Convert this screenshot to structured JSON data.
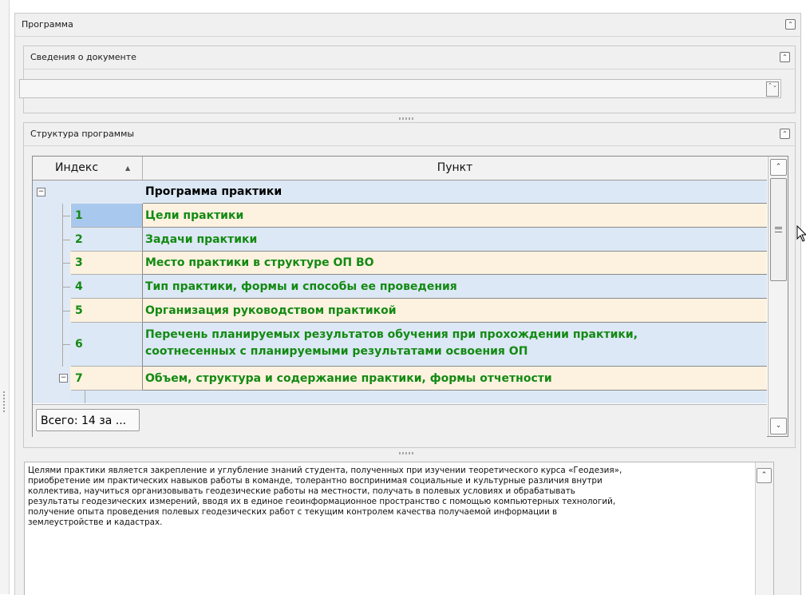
{
  "program_panel": {
    "title": "Программа"
  },
  "document_info": {
    "title": "Сведения о документе",
    "field_value": ""
  },
  "structure": {
    "title": "Структура программы",
    "columns": {
      "index": "Индекс",
      "item": "Пункт"
    },
    "rows": [
      {
        "index": "",
        "label": "Программа практики",
        "style": "header"
      },
      {
        "index": "1",
        "label": "Цели практики"
      },
      {
        "index": "2",
        "label": "Задачи практики"
      },
      {
        "index": "3",
        "label": "Место практики в структуре ОП ВО"
      },
      {
        "index": "4",
        "label": "Тип практики, формы и способы ее проведения"
      },
      {
        "index": "5",
        "label": "Организация руководством практикой"
      },
      {
        "index": "6",
        "label": "Перечень планируемых результатов обучения при прохождении практики,\nсоотнесенных с планируемыми результатами освоения ОП"
      },
      {
        "index": "7",
        "label": "Объем, структура и содержание практики, формы отчетности"
      }
    ],
    "footer_label": "Всего: 14 за ..."
  },
  "description": {
    "text": "Целями практики является закрепление и углубление знаний студента, полученных при изучении теоретического курса «Геодезия»,\nприобретение им практических навыков работы в команде, толерантно воспринимая социальные и культурные различия внутри\nколлектива, научиться организовывать геодезические работы на местности, получать в полевых условиях и обрабатывать\nрезультаты геодезических измерений, вводя их в единое геоинформационное пространство с помощью компьютерных технологий,\nполучение опыта проведения полевых геодезических работ с текущим контролем качества получаемой информации в\nземлеустройстве и кадастрах."
  },
  "icons": {
    "collapse": "⌃",
    "expand_tree": "−",
    "scroll_up": "⌃",
    "scroll_down": "⌄",
    "sort": "▲",
    "spin": "⌃⌄",
    "cursor": "arrow-cursor-icon"
  },
  "colors": {
    "row_blue": "#dce8f5",
    "row_cream": "#fcf2df",
    "item_text": "#138a13",
    "selected": "#a9c8ee"
  }
}
